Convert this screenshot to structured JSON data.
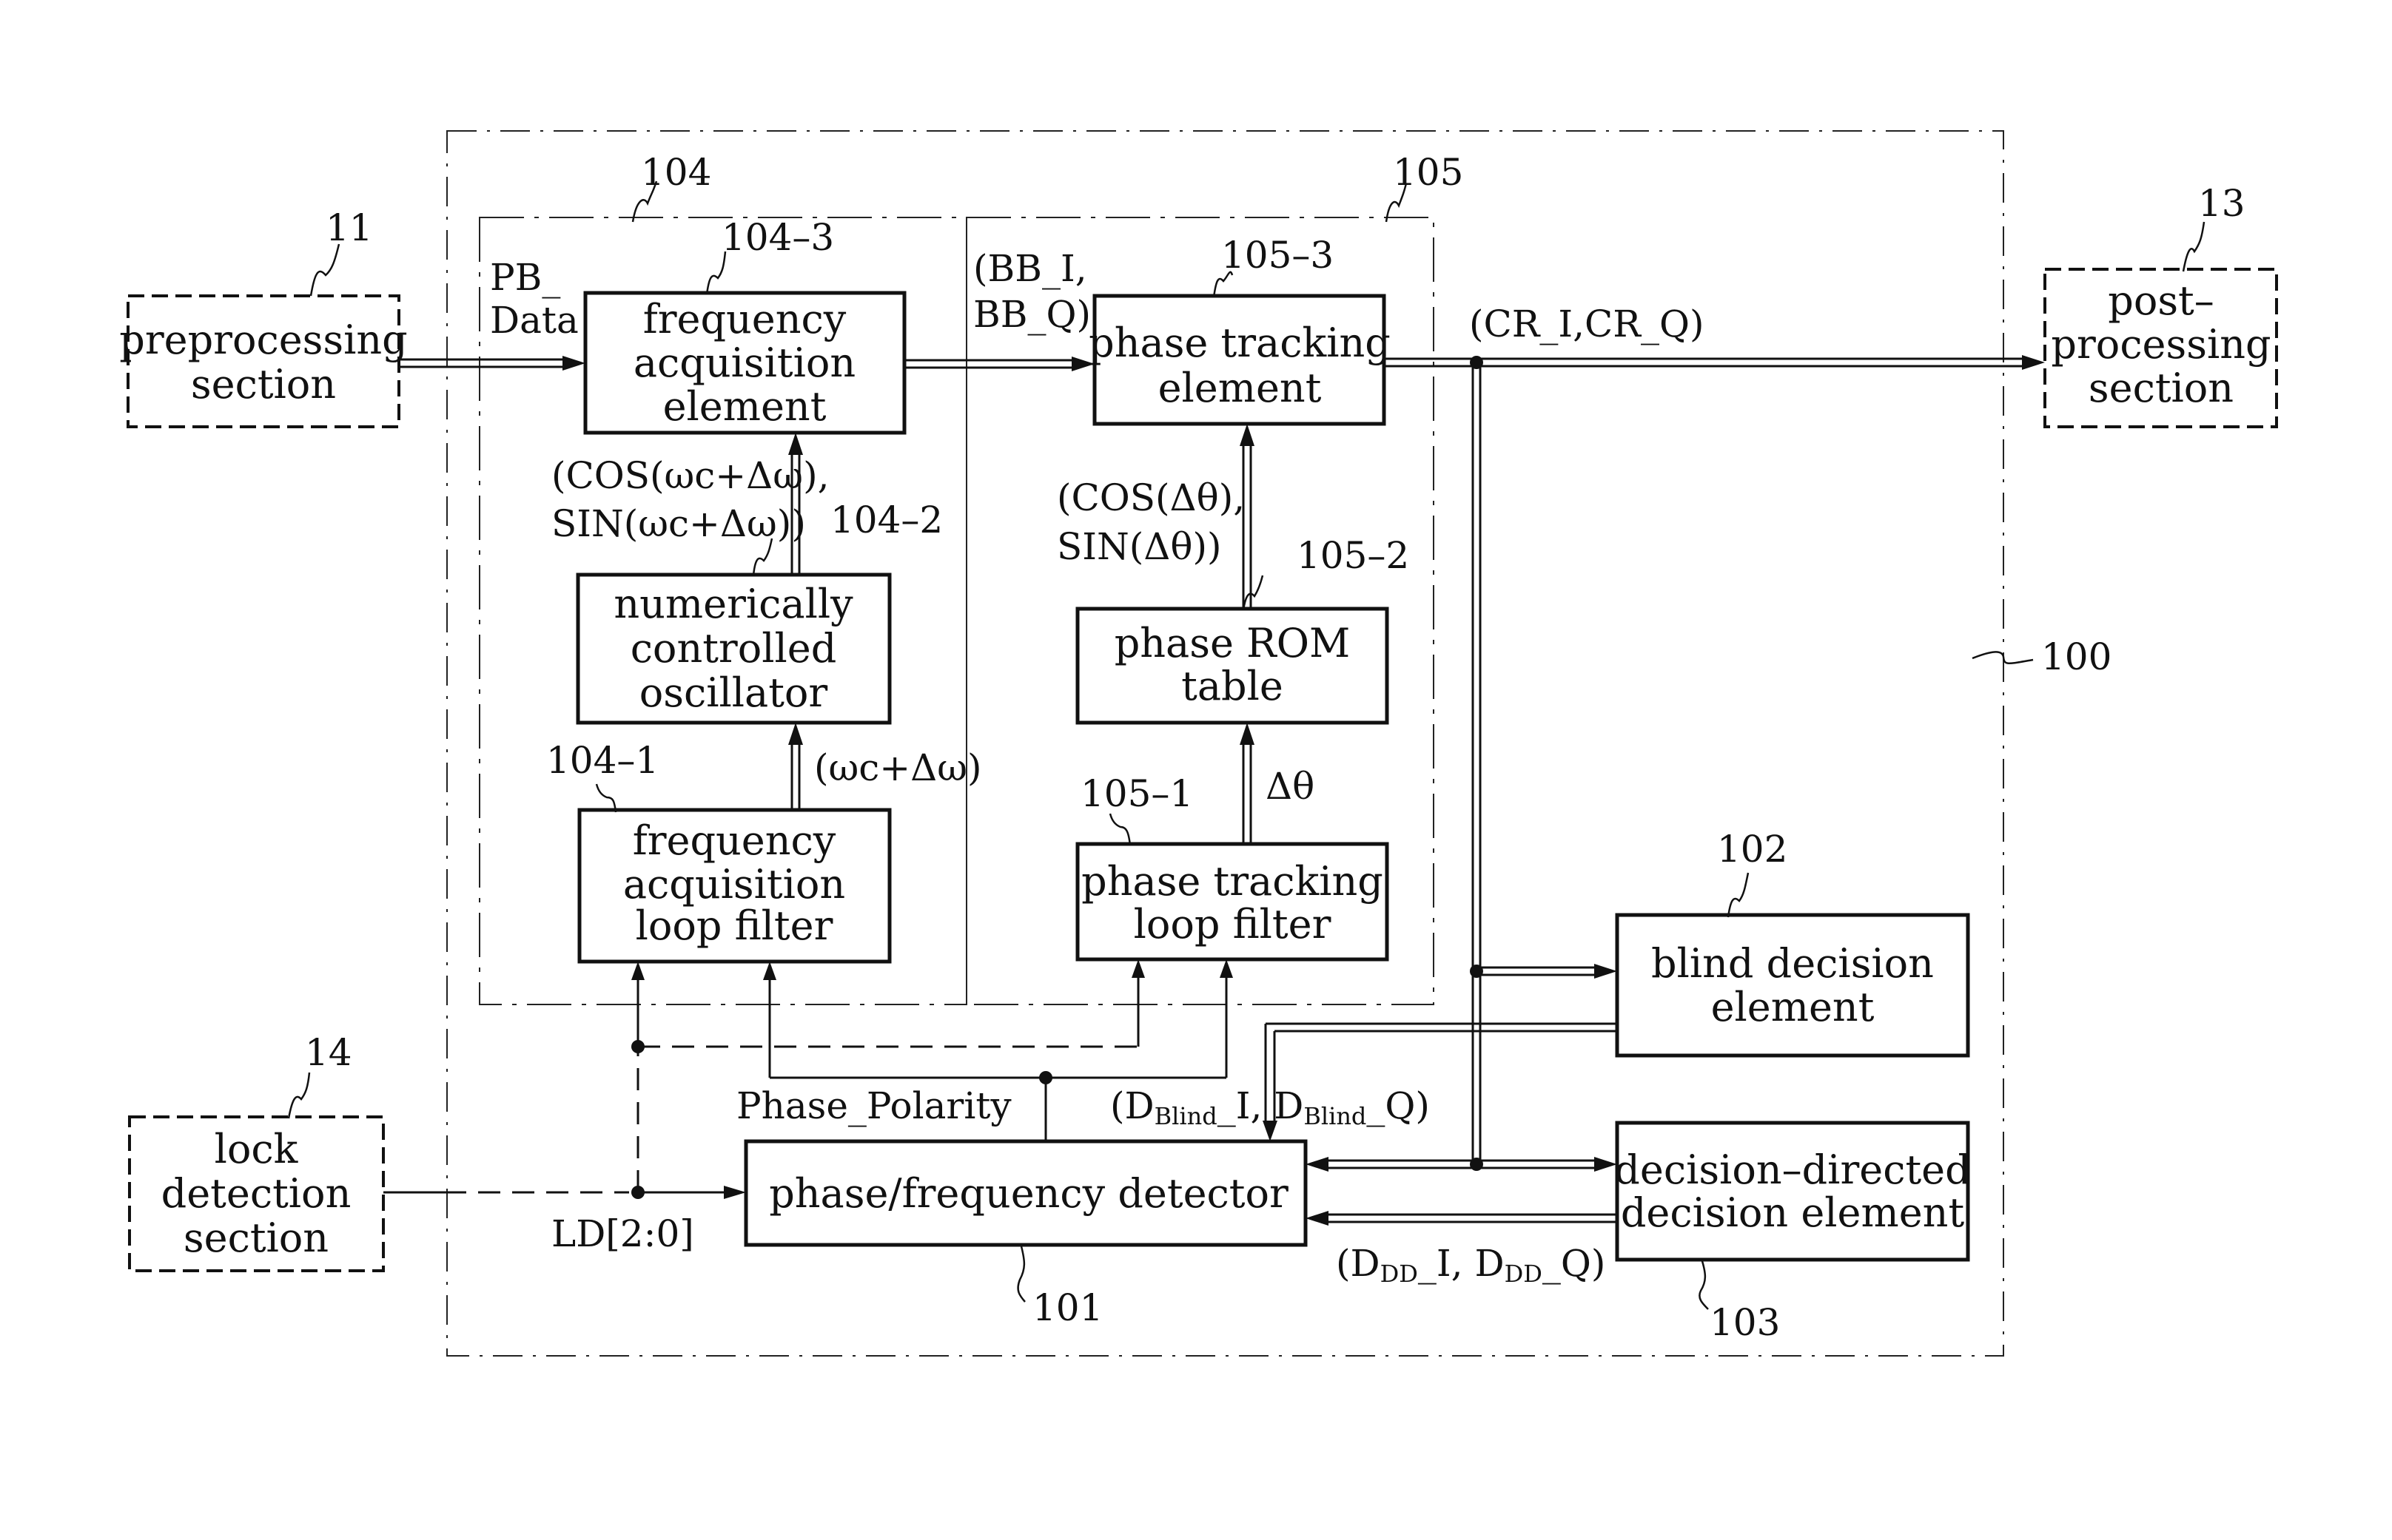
{
  "figure": {
    "system_ref": "100",
    "external_blocks": {
      "preprocessing": {
        "ref": "11",
        "lines": [
          "preprocessing",
          "section"
        ]
      },
      "postprocessing": {
        "ref": "13",
        "lines": [
          "post–",
          "processing",
          "section"
        ]
      },
      "lock_detection": {
        "ref": "14",
        "lines": [
          "lock",
          "detection",
          "section"
        ]
      }
    },
    "groups": {
      "frequency_group": {
        "ref": "104"
      },
      "phase_group": {
        "ref": "105"
      }
    },
    "blocks": {
      "freq_acq_element": {
        "ref": "104–3",
        "lines": [
          "frequency",
          "acquisition",
          "element"
        ]
      },
      "nco": {
        "ref": "104–2",
        "lines": [
          "numerically",
          "controlled",
          "oscillator"
        ]
      },
      "freq_acq_loop_filter": {
        "ref": "104–1",
        "lines": [
          "frequency",
          "acquisition",
          "loop filter"
        ]
      },
      "phase_tracking_element": {
        "ref": "105–3",
        "lines": [
          "phase tracking",
          "element"
        ]
      },
      "phase_rom_table": {
        "ref": "105–2",
        "lines": [
          "phase ROM",
          "table"
        ]
      },
      "phase_tracking_loop_filter": {
        "ref": "105–1",
        "lines": [
          "phase tracking",
          "loop filter"
        ]
      },
      "phase_freq_detector": {
        "ref": "101",
        "lines": [
          "phase/frequency detector"
        ]
      },
      "blind_decision": {
        "ref": "102",
        "lines": [
          "blind decision",
          "element"
        ]
      },
      "dd_decision": {
        "ref": "103",
        "lines": [
          "decision–directed",
          "decision element"
        ]
      }
    },
    "signals": {
      "pb_data": [
        "PB_",
        "Data"
      ],
      "bb": [
        "(BB_I,",
        "BB_Q)"
      ],
      "cr": "(CR_I,CR_Q)",
      "nco_out": [
        "(COS(ωc+Δω),",
        "SIN(ωc+Δω))"
      ],
      "nco_in": "(ωc+Δω)",
      "rom_out": [
        "(COS(Δθ),",
        "SIN(Δθ))"
      ],
      "delta_theta": "Δθ",
      "phase_polarity": "Phase_Polarity",
      "d_blind": {
        "open": "(D",
        "sub1": "Blind",
        "mid": "_I, D",
        "sub2": "Blind",
        "close": "_Q)"
      },
      "d_dd": {
        "open": "(D",
        "sub1": "DD",
        "mid": "_I, D",
        "sub2": "DD",
        "close": "_Q)"
      },
      "ld": "LD[2:0]"
    }
  }
}
